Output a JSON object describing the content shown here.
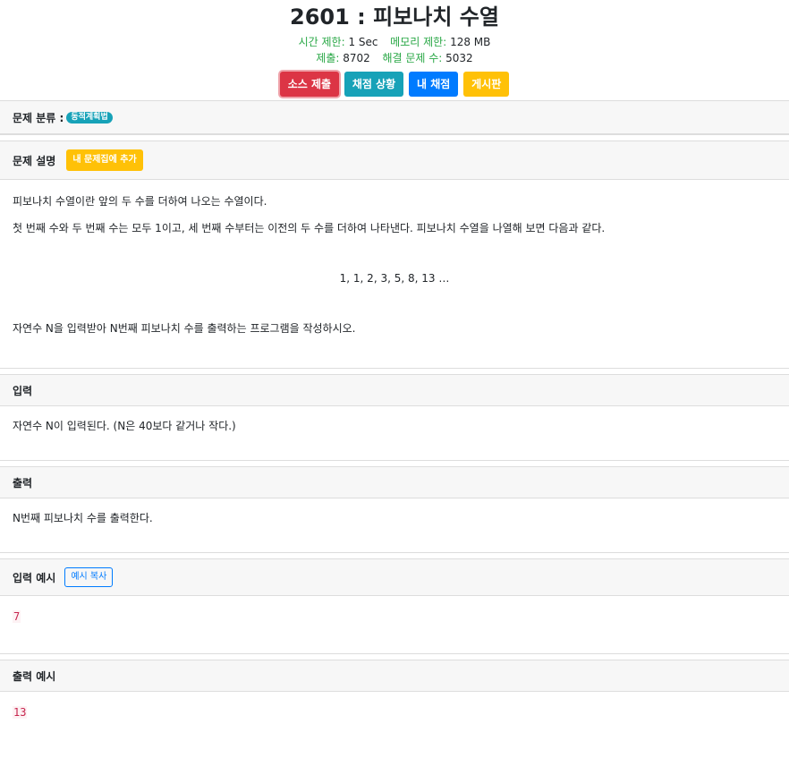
{
  "problem": {
    "title": "2601 : 피보나치 수열",
    "time_limit_label": "시간 제한:",
    "time_limit_value": "1 Sec",
    "memory_limit_label": "메모리 제한:",
    "memory_limit_value": "128 MB",
    "submissions_label": "제출:",
    "submissions_value": "8702",
    "solved_label": "해결 문제 수:",
    "solved_value": "5032"
  },
  "buttons": {
    "submit": "소스 제출",
    "status": "채점 상황",
    "my_submissions": "내 채점",
    "board": "게시판"
  },
  "category": {
    "label": "문제 분류 :",
    "tag": "동적계획법"
  },
  "description": {
    "heading": "문제 설명",
    "add_button": "내 문제집에 추가",
    "para1": "피보나치 수열이란 앞의 두 수를 더하여 나오는 수열이다.",
    "para2": "첫 번째 수와 두 번째 수는 모두 1이고, 세 번째 수부터는 이전의 두 수를 더하여 나타낸다. 피보나치 수열을 나열해 보면 다음과 같다.",
    "sequence": "1, 1, 2, 3, 5, 8, 13 …",
    "para3": "자연수 N을 입력받아 N번째 피보나치 수를 출력하는 프로그램을 작성하시오."
  },
  "input": {
    "heading": "입력",
    "text": "자연수 N이 입력된다. (N은 40보다 같거나 작다.)"
  },
  "output": {
    "heading": "출력",
    "text": "N번째 피보나치 수를 출력한다."
  },
  "sample_input": {
    "heading": "입력 예시",
    "copy_button": "예시 복사",
    "value": "7"
  },
  "sample_output": {
    "heading": "출력 예시",
    "value": "13"
  },
  "colors": {
    "danger": "#dc3545",
    "info": "#17a2b8",
    "primary": "#007bff",
    "warning": "#ffc107",
    "label_green": "#28a745"
  }
}
